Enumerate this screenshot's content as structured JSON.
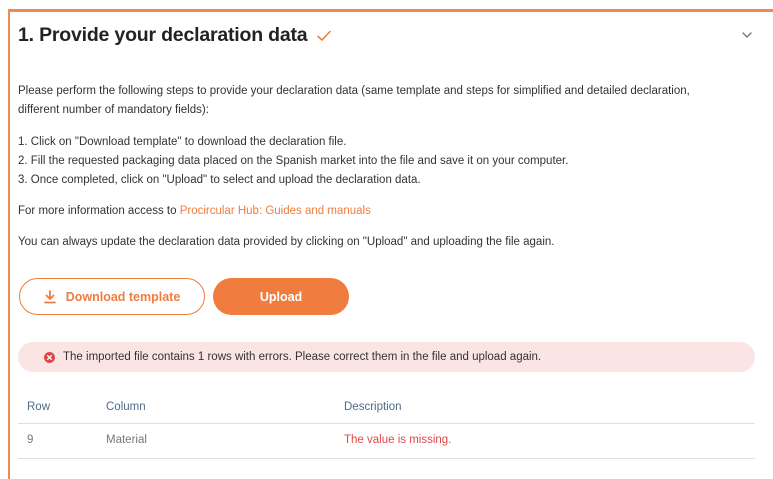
{
  "section": {
    "title": "1. Provide your declaration data",
    "intro_line1": "Please perform the following steps to provide your declaration data (same template and steps for simplified and detailed declaration,",
    "intro_line2": "different number of mandatory fields):",
    "steps": [
      "1. Click on \"Download template\" to download the declaration file.",
      "2. Fill the requested packaging data placed on the Spanish market into the file and save it on your computer.",
      "3. Once completed, click on \"Upload\" to select and upload the declaration data."
    ],
    "more_info_prefix": "For more information access to ",
    "more_info_link": "Procircular Hub: Guides and manuals",
    "update_note": "You can always update the declaration data provided by clicking on \"Upload\" and uploading the file again."
  },
  "buttons": {
    "download": "Download template",
    "upload": "Upload"
  },
  "alert": {
    "message": "The imported file contains 1 rows with errors. Please correct them in the file and upload again."
  },
  "table": {
    "headers": [
      "Row",
      "Column",
      "Description"
    ],
    "rows": [
      [
        "9",
        "Material",
        "The value is missing."
      ]
    ]
  },
  "colors": {
    "accent": "#f07c3e",
    "error": "#e04848",
    "alert_bg": "#fbe4e4"
  },
  "icons": [
    "check-icon",
    "chevron-down-icon",
    "download-icon",
    "error-circle-icon"
  ]
}
